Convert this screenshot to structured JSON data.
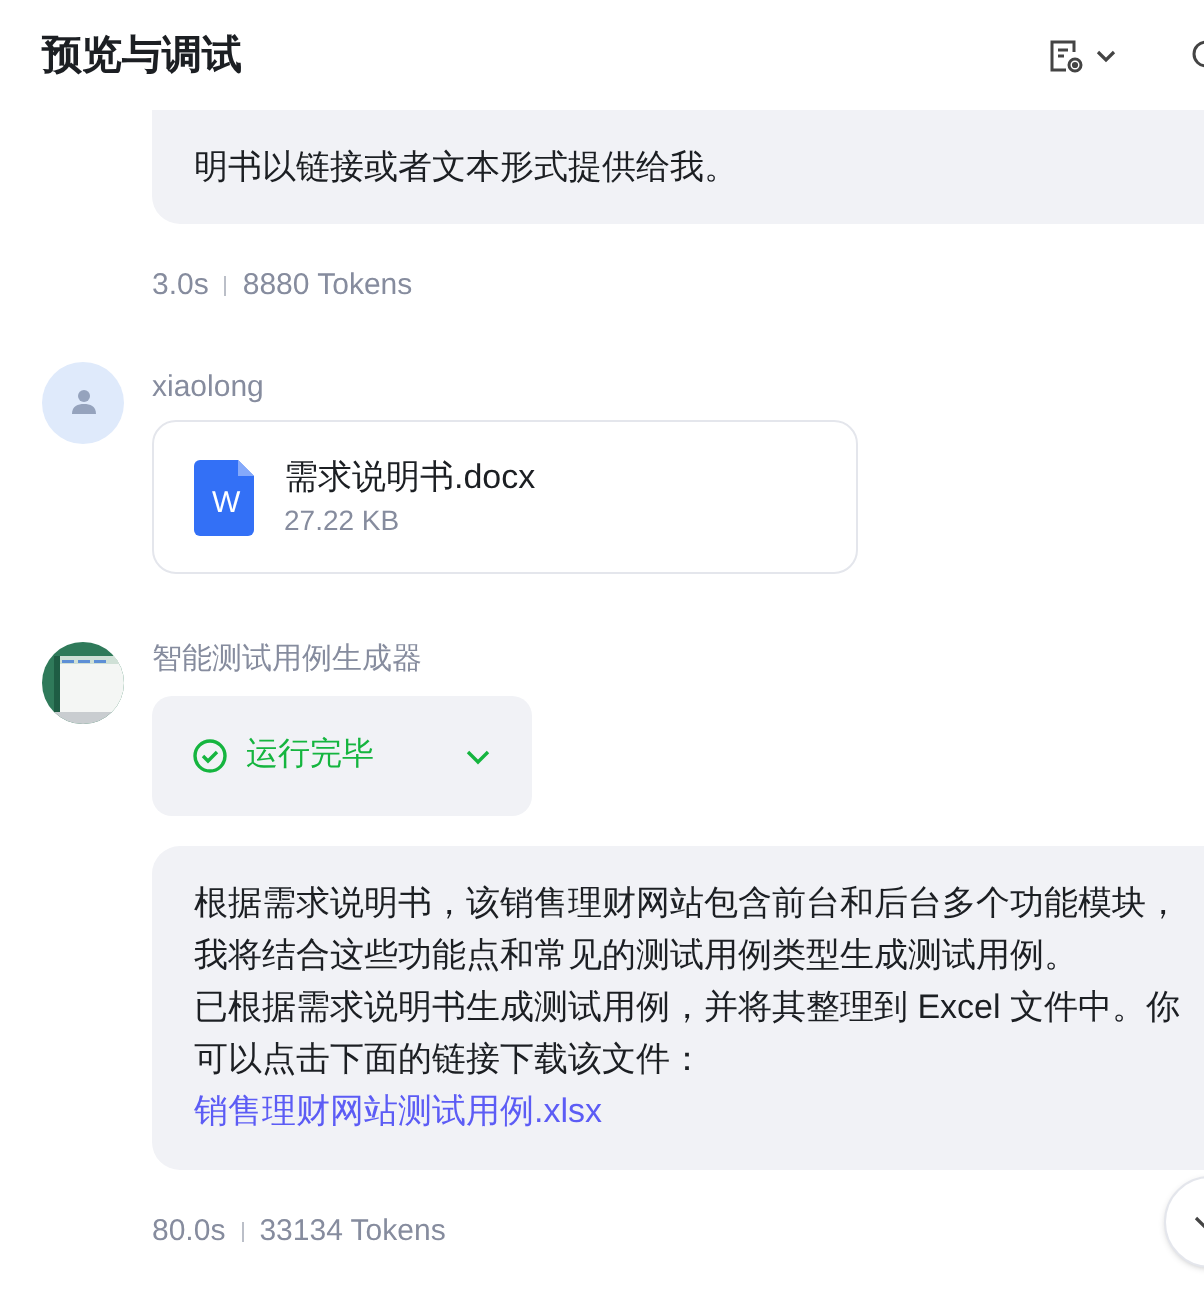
{
  "header": {
    "title": "预览与调试"
  },
  "messages": [
    {
      "kind": "bot_tail",
      "lines": [
        "明书以链接或者文本形式提供给我。"
      ],
      "duration": "3.0s",
      "tokens": "8880 Tokens"
    },
    {
      "kind": "user_file",
      "sender": "xiaolong",
      "file": {
        "name": "需求说明书.docx",
        "size": "27.22 KB",
        "icon_letter": "W"
      }
    },
    {
      "kind": "bot_full",
      "sender": "智能测试用例生成器",
      "status": {
        "label": "运行完毕",
        "expanded": false
      },
      "paragraphs": [
        "根据需求说明书，该销售理财网站包含前台和后台多个功能模块，我将结合这些功能点和常见的测试用例类型生成测试用例。",
        "已根据需求说明书生成测试用例，并将其整理到 Excel 文件中。你可以点击下面的链接下载该文件："
      ],
      "link": "销售理财网站测试用例.xlsx",
      "duration": "80.0s",
      "tokens": "33134 Tokens"
    }
  ]
}
